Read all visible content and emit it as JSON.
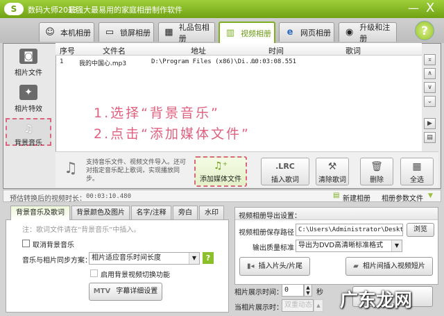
{
  "titlebar": {
    "app_name": "数码大师2013",
    "slogan": "最强大最易用的家庭相册制作软件",
    "logo": "S",
    "minimize": "—",
    "close": "X"
  },
  "tabs": [
    {
      "label": "本机相册",
      "icon": "portrait-icon"
    },
    {
      "label": "锁屏相册",
      "icon": "monitor-icon"
    },
    {
      "label": "礼品包相册",
      "icon": "gift-icon"
    },
    {
      "label": "视频相册",
      "icon": "film-icon",
      "active": true
    },
    {
      "label": "网页相册",
      "icon": "ie-icon"
    },
    {
      "label": "升级和注册",
      "icon": "globe-icon"
    }
  ],
  "help": "?",
  "sidebar": [
    {
      "label": "相片文件"
    },
    {
      "label": "相片特效"
    },
    {
      "label": "背景音乐",
      "active": true
    }
  ],
  "table": {
    "headers": [
      "序号",
      "文件名",
      "地址",
      "时间",
      "歌词"
    ],
    "rows": [
      [
        "1",
        "我的中国心.mp3",
        "D:\\Program Files (x86)\\Di...",
        "00:03:08.551",
        ""
      ]
    ]
  },
  "annotation": {
    "line1": "1.选择“背景音乐”",
    "line2": "2.点击“添加媒体文件”",
    "color": "#e0607f"
  },
  "toolbar": {
    "hint": "支持音乐文件、视频文件导入。还可对指定音乐配上歌词，实现播放同步。",
    "add_media": "添加媒体文件",
    "insert_lyrics_icon": ".LRC",
    "insert_lyrics": "插入歌词",
    "clear_lyrics": "清除歌词",
    "delete": "删除",
    "select_all": "全选"
  },
  "status": {
    "duration_label": "预估转换后的视频时长：",
    "duration": "00:03:10.480",
    "new_album": "新建相册",
    "album_params": "相册参数文件"
  },
  "bottom_tabs": [
    "背景音乐及歌词",
    "背景颜色及图片",
    "名字/注释",
    "旁白",
    "水印"
  ],
  "music": {
    "note": "注：歌词文件请在“背景音乐”中插入。",
    "cancel_bg_music": "取消背景音乐",
    "sync_label": "音乐与相片同步方案：",
    "sync_value": "相片适应音乐时间长度",
    "bg_video_switch": "启用背景视频切换功能",
    "mtv_icon": "MTV",
    "mtv_settings": "字幕详细设置"
  },
  "export": {
    "title": "视频相册导出设置：",
    "path_label": "视频相册保存路径：",
    "path_value": "C:\\Users\\Administrator\\Desktop",
    "browse": "浏览",
    "quality_label": "输出质量标准：",
    "quality_value": "导出为DVD高清晰标准格式",
    "insert_head_tail": "插入片头/片尾",
    "insert_video_clip": "相片间插入视频短片"
  },
  "display": {
    "time_label": "相片展示时间：",
    "time_value": "0",
    "time_unit": "秒",
    "when_label": "当相片展示时：",
    "when_value": "双重动态"
  },
  "watermark": "广东龙网"
}
